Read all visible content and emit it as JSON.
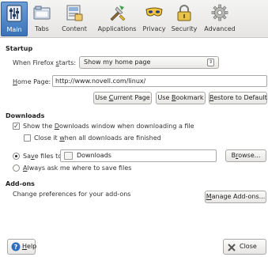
{
  "tabs": [
    {
      "label": "Main",
      "icon": "main-panel-icon",
      "active": true
    },
    {
      "label": "Tabs",
      "icon": "tabs-icon",
      "active": false
    },
    {
      "label": "Content",
      "icon": "content-icon",
      "active": false
    },
    {
      "label": "Applications",
      "icon": "applications-icon",
      "active": false
    },
    {
      "label": "Privacy",
      "icon": "privacy-mask-icon",
      "active": false
    },
    {
      "label": "Security",
      "icon": "padlock-icon",
      "active": false
    },
    {
      "label": "Advanced",
      "icon": "gear-icon",
      "active": false
    }
  ],
  "startup": {
    "heading": "Startup",
    "when_label_pre": "When Firefox ",
    "when_label_key": "s",
    "when_label_post": "tarts:",
    "when_value": "Show my home page",
    "home_label_key": "H",
    "home_label_post": "ome Page:",
    "home_value": "http://www.novell.com/linux/",
    "use_current_pre": "Use ",
    "use_current_key": "C",
    "use_current_post": "urrent Page",
    "use_bookmark_pre": "Use ",
    "use_bookmark_key": "B",
    "use_bookmark_post": "ookmark",
    "restore_key": "R",
    "restore_post": "estore to Default"
  },
  "downloads": {
    "heading": "Downloads",
    "show_window_pre": "Show the ",
    "show_window_key": "D",
    "show_window_post": "ownloads window when downloading a file",
    "show_window_checked": true,
    "close_it_pre": "Close it ",
    "close_it_key": "w",
    "close_it_post": "hen all downloads are finished",
    "close_it_checked": false,
    "save_files_pre": "Sa",
    "save_files_key": "v",
    "save_files_post": "e files to",
    "save_files_selected": true,
    "folder": "Downloads",
    "browse_pre": "B",
    "browse_key": "r",
    "browse_post": "owse...",
    "always_ask_key": "A",
    "always_ask_post": "lways ask me where to save files"
  },
  "addons": {
    "heading": "Add-ons",
    "description": "Change preferences for your add-ons",
    "manage_key": "M",
    "manage_post": "anage Add-ons..."
  },
  "footer": {
    "help_key": "H",
    "help_post": "elp",
    "close_label": "Close"
  },
  "colors": {
    "active_tab": "#3b73b8",
    "help_icon": "#2f6fc0"
  }
}
